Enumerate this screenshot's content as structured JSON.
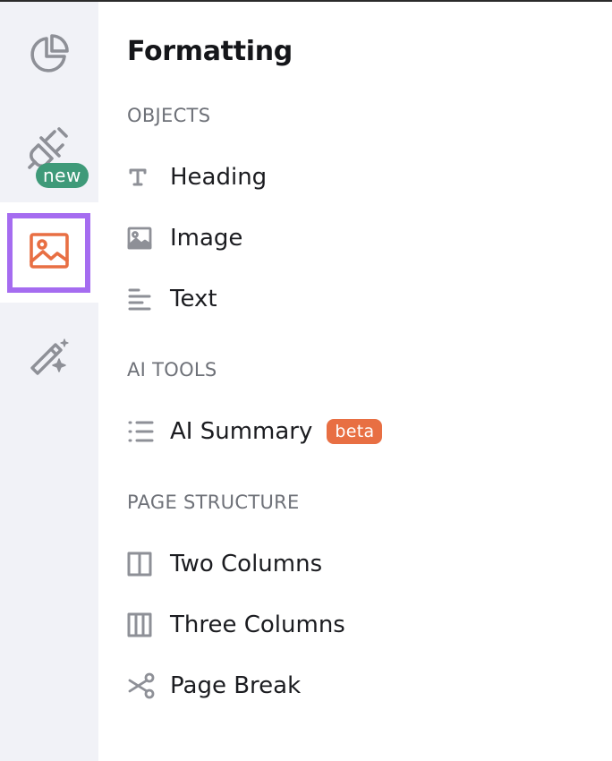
{
  "colors": {
    "rail_bg": "#f1f2f7",
    "active_outline": "#a56cf0",
    "accent_orange": "#e86f43",
    "new_badge": "#3f9a79",
    "icon_gray": "#8e9097"
  },
  "rail": {
    "items": [
      {
        "icon": "pie-chart-icon"
      },
      {
        "icon": "plug-icon",
        "badge": "new"
      },
      {
        "icon": "image-icon",
        "active": true
      },
      {
        "icon": "magic-wand-icon"
      }
    ]
  },
  "panel": {
    "title": "Formatting",
    "sections": [
      {
        "heading": "OBJECTS",
        "items": [
          {
            "label": "Heading",
            "icon": "text-t-icon"
          },
          {
            "label": "Image",
            "icon": "image-icon"
          },
          {
            "label": "Text",
            "icon": "align-left-icon"
          }
        ]
      },
      {
        "heading": "AI TOOLS",
        "items": [
          {
            "label": "AI Summary",
            "icon": "list-icon",
            "badge": "beta"
          }
        ]
      },
      {
        "heading": "PAGE STRUCTURE",
        "items": [
          {
            "label": "Two Columns",
            "icon": "two-columns-icon"
          },
          {
            "label": "Three Columns",
            "icon": "three-columns-icon"
          },
          {
            "label": "Page Break",
            "icon": "scissors-icon"
          }
        ]
      }
    ]
  }
}
